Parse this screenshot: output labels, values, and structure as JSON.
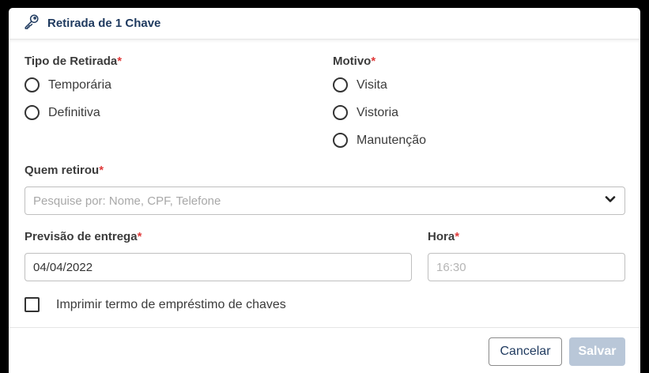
{
  "dialog": {
    "title": "Retirada de 1 Chave",
    "title_icon": "key-icon"
  },
  "tipo_retirada": {
    "label": "Tipo de Retirada",
    "required_mark": "*",
    "options": [
      "Temporária",
      "Definitiva"
    ]
  },
  "motivo": {
    "label": "Motivo",
    "required_mark": "*",
    "options": [
      "Visita",
      "Vistoria",
      "Manutenção"
    ]
  },
  "quem_retirou": {
    "label": "Quem retirou",
    "required_mark": "*",
    "placeholder": "Pesquise por: Nome, CPF, Telefone",
    "dropdown_icon": "chevron-down-icon"
  },
  "previsao": {
    "label": "Previsão de entrega",
    "required_mark": "*",
    "value": "04/04/2022"
  },
  "hora": {
    "label": "Hora",
    "required_mark": "*",
    "placeholder": "16:30"
  },
  "imprimir": {
    "label": "Imprimir termo de empréstimo de chaves"
  },
  "footer": {
    "cancel_label": "Cancelar",
    "save_label": "Salvar"
  },
  "colors": {
    "accent": "#1f3a5f",
    "required": "#e03a3a",
    "save_disabled": "#b9c7d8"
  }
}
